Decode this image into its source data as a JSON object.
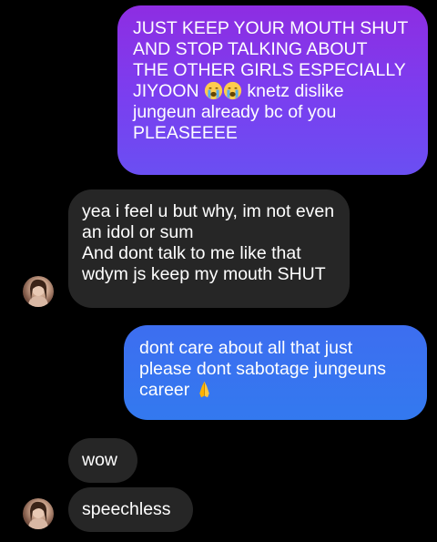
{
  "conversation": {
    "messages": [
      {
        "direction": "sent",
        "text_before": "JUST KEEP YOUR MOUTH SHUT\nAND STOP TALKING ABOUT\nTHE OTHER GIRLS ESPECIALLY\nJIYOON ",
        "emoji": [
          "crying-face",
          "crying-face"
        ],
        "text_after": " knetz dislike\njungeun already bc of you\nPLEASEEEE",
        "bubble_color": "#7a3ff0"
      },
      {
        "direction": "received",
        "text": "yea i feel u but why, im not even\nan idol or sum\nAnd dont talk to me like that\nwdym js keep my mouth SHUT",
        "bubble_color": "#262626"
      },
      {
        "direction": "sent",
        "text_before": "dont care about all that just\nplease dont sabotage jungeuns\ncareer ",
        "emoji": [
          "folded-hands"
        ],
        "bubble_color": "#3379ef"
      },
      {
        "direction": "received",
        "text": "wow",
        "bubble_color": "#262626"
      },
      {
        "direction": "received",
        "text": "speechless",
        "bubble_color": "#262626"
      }
    ]
  }
}
